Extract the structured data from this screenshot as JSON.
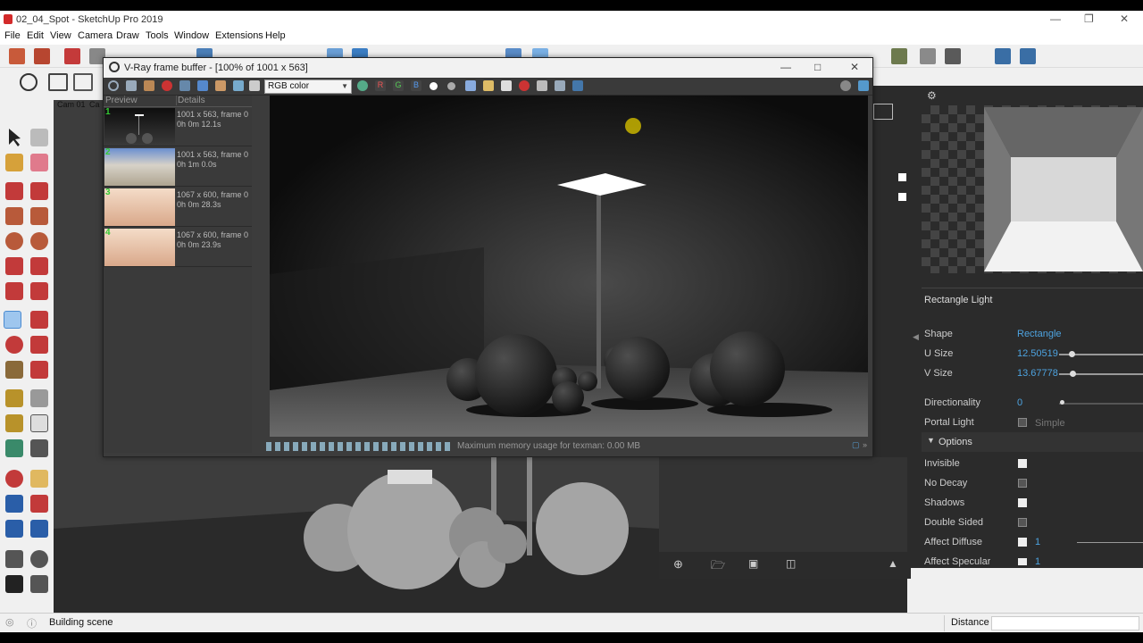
{
  "window": {
    "title": "02_04_Spot - SketchUp Pro 2019"
  },
  "menu": [
    "File",
    "Edit",
    "View",
    "Camera",
    "Draw",
    "Tools",
    "Window",
    "Extensions",
    "Help"
  ],
  "scene_tabs": [
    "Cam 01",
    "Ca"
  ],
  "vfb": {
    "title": "V-Ray frame buffer - [100% of 1001 x 563]",
    "channel": "RGB color",
    "channel_buttons": [
      "R",
      "G",
      "B"
    ],
    "history_headers": {
      "preview": "Preview",
      "details": "Details"
    },
    "history": [
      {
        "num": "1",
        "size": "1001 x 563, frame 0",
        "time": "0h 0m 12.1s"
      },
      {
        "num": "2",
        "size": "1001 x 563, frame 0",
        "time": "0h 1m 0.0s"
      },
      {
        "num": "3",
        "size": "1067 x 600, frame 0",
        "time": "0h 0m 28.3s"
      },
      {
        "num": "4",
        "size": "1067 x 600, frame 0",
        "time": "0h 0m 23.9s"
      }
    ],
    "status": "Maximum memory usage for texman: 0.00 MB"
  },
  "light_panel": {
    "header": "Rectangle Light",
    "shape": {
      "label": "Shape",
      "value": "Rectangle"
    },
    "u_size": {
      "label": "U Size",
      "value": "12.50519"
    },
    "v_size": {
      "label": "V Size",
      "value": "13.67778"
    },
    "directionality": {
      "label": "Directionality",
      "value": "0"
    },
    "portal_light": {
      "label": "Portal Light",
      "option": "Simple",
      "checked": false
    },
    "options_header": "Options",
    "options": [
      {
        "label": "Invisible",
        "checked": true,
        "value": ""
      },
      {
        "label": "No Decay",
        "checked": false,
        "value": ""
      },
      {
        "label": "Shadows",
        "checked": true,
        "value": ""
      },
      {
        "label": "Double Sided",
        "checked": false,
        "value": ""
      },
      {
        "label": "Affect Diffuse",
        "checked": true,
        "value": "1"
      },
      {
        "label": "Affect Specular",
        "checked": true,
        "value": "1"
      }
    ]
  },
  "status": {
    "message": "Building scene",
    "measure_label": "Distance"
  },
  "colors": {
    "accent": "#4da3e0",
    "panel_bg": "#2b2b2b",
    "sketchup_red": "#d32a2a"
  }
}
